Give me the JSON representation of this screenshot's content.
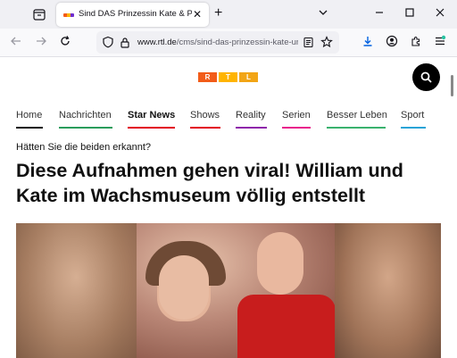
{
  "browser": {
    "tab_title": "Sind DAS Prinzessin Kate & Prinz William?",
    "tab_close": "✕",
    "new_tab": "+",
    "url_domain": "www.rtl.de",
    "url_path": "/cms/sind-das-prinzessin-kate-und-prinz-william",
    "icons": [
      "tab-list-icon",
      "back-icon",
      "forward-icon",
      "reload-icon",
      "shield-icon",
      "lock-icon",
      "reader-view-icon",
      "bookmark-star-icon",
      "download-icon",
      "account-icon",
      "extensions-icon",
      "app-menu-icon"
    ]
  },
  "site": {
    "logo_letters": [
      "R",
      "T",
      "L"
    ],
    "logo_colors": [
      "#f25c19",
      "#ffb400",
      "#f2a516"
    ],
    "nav": [
      {
        "label": "Home",
        "color": "#111111"
      },
      {
        "label": "Nachrichten",
        "color": "#2a9d5c"
      },
      {
        "label": "Star News",
        "color": "#e2001a"
      },
      {
        "label": "Shows",
        "color": "#e2001a"
      },
      {
        "label": "Reality",
        "color": "#8e24aa"
      },
      {
        "label": "Serien",
        "color": "#e91e8c"
      },
      {
        "label": "Besser Leben",
        "color": "#3ab26e"
      },
      {
        "label": "Sport",
        "color": "#29a3d6"
      }
    ]
  },
  "article": {
    "kicker": "Hätten Sie die beiden erkannt?",
    "headline": "Diese Aufnahmen gehen viral! William und Kate im Wachsmuseum völlig entstellt"
  }
}
